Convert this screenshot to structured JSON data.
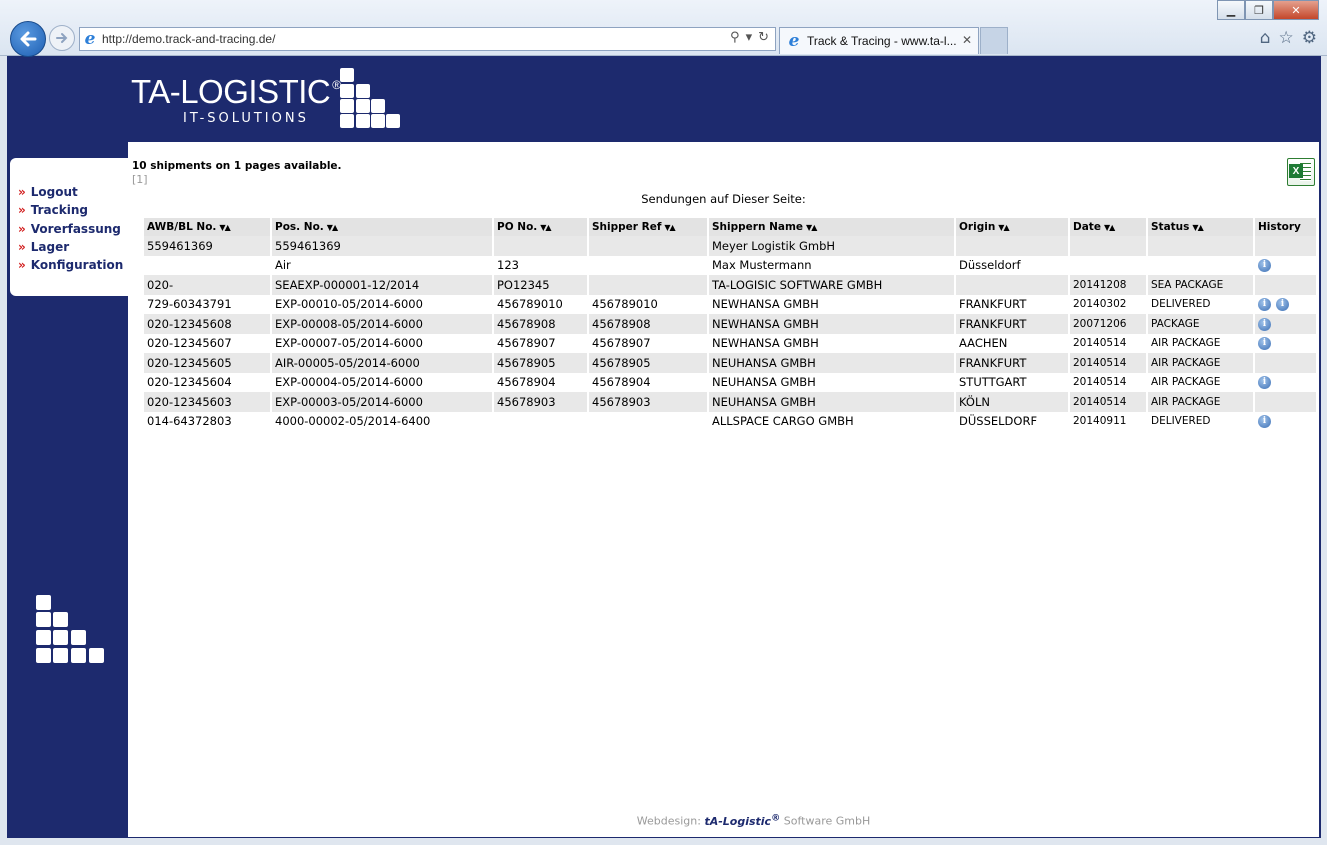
{
  "browser": {
    "url": "http://demo.track-and-tracing.de/",
    "tab_title": "Track & Tracing - www.ta-l...",
    "tab_close": "✕",
    "win_min": "▁",
    "win_max": "❐",
    "win_close": "✕"
  },
  "logo": {
    "main": "TA-LOGISTIC",
    "reg": "®",
    "sub": "IT-SOLUTIONS"
  },
  "menu": [
    {
      "label": "Logout"
    },
    {
      "label": "Tracking"
    },
    {
      "label": "Vorerfassung"
    },
    {
      "label": "Lager"
    },
    {
      "label": "Konfiguration"
    }
  ],
  "menu_chevron": "»",
  "summary": "10 shipments on 1 pages available.",
  "pager": "[1]",
  "sub_header": "Sendungen auf Dieser Seite:",
  "sort_glyph": "▼▲",
  "columns": [
    "AWB/BL No.",
    "Pos. No.",
    "PO No.",
    "Shipper Ref",
    "Shippern Name",
    "Origin",
    "Date",
    "Status",
    "History"
  ],
  "rows": [
    {
      "awb": "559461369",
      "pos": "559461369",
      "po": "",
      "ref": "",
      "name": "Meyer Logistik GmbH",
      "origin": "",
      "date": "",
      "status": "",
      "history": 0
    },
    {
      "awb": "",
      "pos": "Air",
      "po": "123",
      "ref": "",
      "name": "Max Mustermann",
      "origin": "Düsseldorf",
      "date": "",
      "status": "",
      "history": 1
    },
    {
      "awb": "020-",
      "pos": "SEAEXP-000001-12/2014",
      "po": "PO12345",
      "ref": "",
      "name": "TA-LOGISIC SOFTWARE GMBH",
      "origin": "",
      "date": "20141208",
      "status": "SEA PACKAGE",
      "history": 0
    },
    {
      "awb": "729-60343791",
      "pos": "EXP-00010-05/2014-6000",
      "po": "456789010",
      "ref": "456789010",
      "name": "NEWHANSA GMBH",
      "origin": "FRANKFURT",
      "date": "20140302",
      "status": "DELIVERED",
      "history": 2
    },
    {
      "awb": "020-12345608",
      "pos": "EXP-00008-05/2014-6000",
      "po": "45678908",
      "ref": "45678908",
      "name": "NEWHANSA GMBH",
      "origin": "FRANKFURT",
      "date": "20071206",
      "status": "PACKAGE",
      "history": 1
    },
    {
      "awb": "020-12345607",
      "pos": "EXP-00007-05/2014-6000",
      "po": "45678907",
      "ref": "45678907",
      "name": "NEWHANSA GMBH",
      "origin": "AACHEN",
      "date": "20140514",
      "status": "AIR PACKAGE",
      "history": 1
    },
    {
      "awb": "020-12345605",
      "pos": "AIR-00005-05/2014-6000",
      "po": "45678905",
      "ref": "45678905",
      "name": "NEUHANSA GMBH",
      "origin": "FRANKFURT",
      "date": "20140514",
      "status": "AIR PACKAGE",
      "history": 0
    },
    {
      "awb": "020-12345604",
      "pos": "EXP-00004-05/2014-6000",
      "po": "45678904",
      "ref": "45678904",
      "name": "NEUHANSA GMBH",
      "origin": "STUTTGART",
      "date": "20140514",
      "status": "AIR PACKAGE",
      "history": 1
    },
    {
      "awb": "020-12345603",
      "pos": "EXP-00003-05/2014-6000",
      "po": "45678903",
      "ref": "45678903",
      "name": "NEUHANSA GMBH",
      "origin": "KÖLN",
      "date": "20140514",
      "status": "AIR PACKAGE",
      "history": 0
    },
    {
      "awb": "014-64372803",
      "pos": "4000-00002-05/2014-6400",
      "po": "",
      "ref": "",
      "name": "ALLSPACE CARGO GMBH",
      "origin": "DÜSSELDORF",
      "date": "20140911",
      "status": "DELIVERED",
      "history": 1
    }
  ],
  "info_glyph": "i",
  "footer": {
    "prefix": "Webdesign:",
    "brand": "tA-Logistic",
    "reg": "®",
    "suffix": "Software GmbH"
  },
  "colors": {
    "brand_navy": "#1d2a6e",
    "accent_red": "#d21f1f",
    "row_alt": "#e8e8e8"
  }
}
